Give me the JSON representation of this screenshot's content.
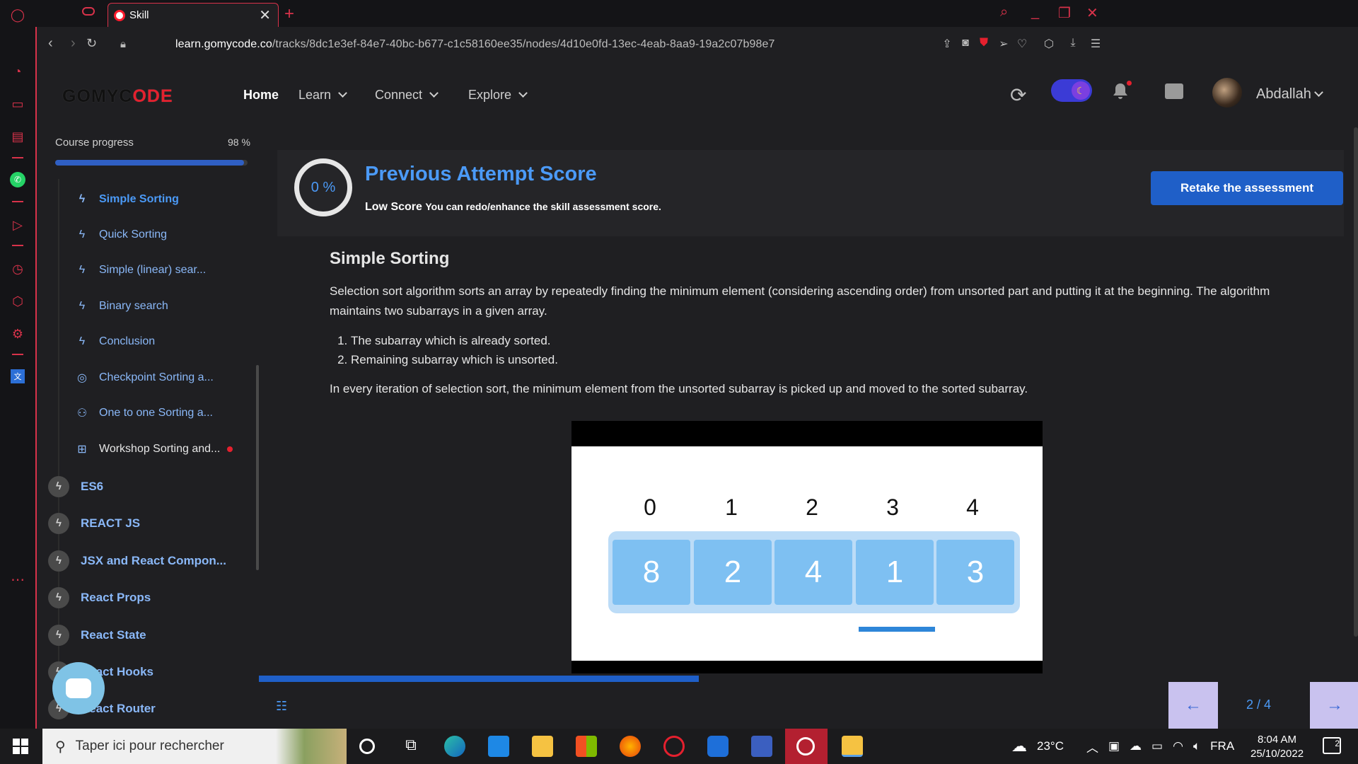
{
  "browser": {
    "tab_title": "Skill",
    "tab_close": "✕",
    "new_tab": "+",
    "url_host": "learn.gomycode.co",
    "url_path": "/tracks/8dc1e3ef-84e7-40bc-b677-c1c58160ee35/nodes/4d10e0fd-13ec-4eab-8aa9-19a2c07b98e7"
  },
  "header": {
    "logo_part1": "GOMYC",
    "logo_part2": "ODE",
    "nav": [
      {
        "label": "Home"
      },
      {
        "label": "Learn"
      },
      {
        "label": "Connect"
      },
      {
        "label": "Explore"
      }
    ],
    "username": "Abdallah"
  },
  "sidebar": {
    "progress_label": "Course progress",
    "progress_pct_text": "98 %",
    "progress_value": 0.98,
    "sub_items": [
      {
        "label": "Simple Sorting",
        "icon": "bolt-icon"
      },
      {
        "label": "Quick Sorting",
        "icon": "bolt-icon"
      },
      {
        "label": "Simple (linear) sear...",
        "icon": "bolt-icon"
      },
      {
        "label": "Binary search",
        "icon": "bolt-icon"
      },
      {
        "label": "Conclusion",
        "icon": "bolt-icon"
      },
      {
        "label": "Checkpoint Sorting a...",
        "icon": "target-icon"
      },
      {
        "label": "One to one Sorting a...",
        "icon": "pair-icon"
      },
      {
        "label": "Workshop Sorting and...",
        "icon": "workshop-icon"
      }
    ],
    "modules": [
      {
        "label": "ES6"
      },
      {
        "label": "REACT JS"
      },
      {
        "label": "JSX and React Compon..."
      },
      {
        "label": "React Props"
      },
      {
        "label": "React State"
      },
      {
        "label": "React Hooks"
      },
      {
        "label": "React Router"
      }
    ]
  },
  "score": {
    "value_text": "0 %",
    "title": "Previous Attempt Score",
    "low_label": "Low Score",
    "description": "You can redo/enhance the skill assessment score.",
    "retake_label": "Retake the assessment"
  },
  "lesson": {
    "title": "Simple Sorting",
    "paragraph1": "Selection sort algorithm sorts an array by repeatedly finding the minimum element (considering ascending order) from unsorted part and putting it at the beginning. The algorithm maintains two subarrays in a given array.",
    "list": [
      "The subarray which is already sorted.",
      "Remaining subarray which is unsorted."
    ],
    "paragraph2": "In every iteration of selection sort, the minimum element from the unsorted subarray is picked up and moved to the sorted subarray.",
    "video": {
      "indices": [
        "0",
        "1",
        "2",
        "3",
        "4"
      ],
      "values": [
        "8",
        "2",
        "4",
        "1",
        "3"
      ]
    }
  },
  "footer": {
    "pager_text": "2 / 4",
    "prev_arrow": "←",
    "next_arrow": "→"
  },
  "taskbar": {
    "search_placeholder": "Taper ici pour rechercher",
    "temperature": "23°C",
    "language": "FRA",
    "time": "8:04 AM",
    "date": "25/10/2022",
    "notification_count": "2"
  }
}
